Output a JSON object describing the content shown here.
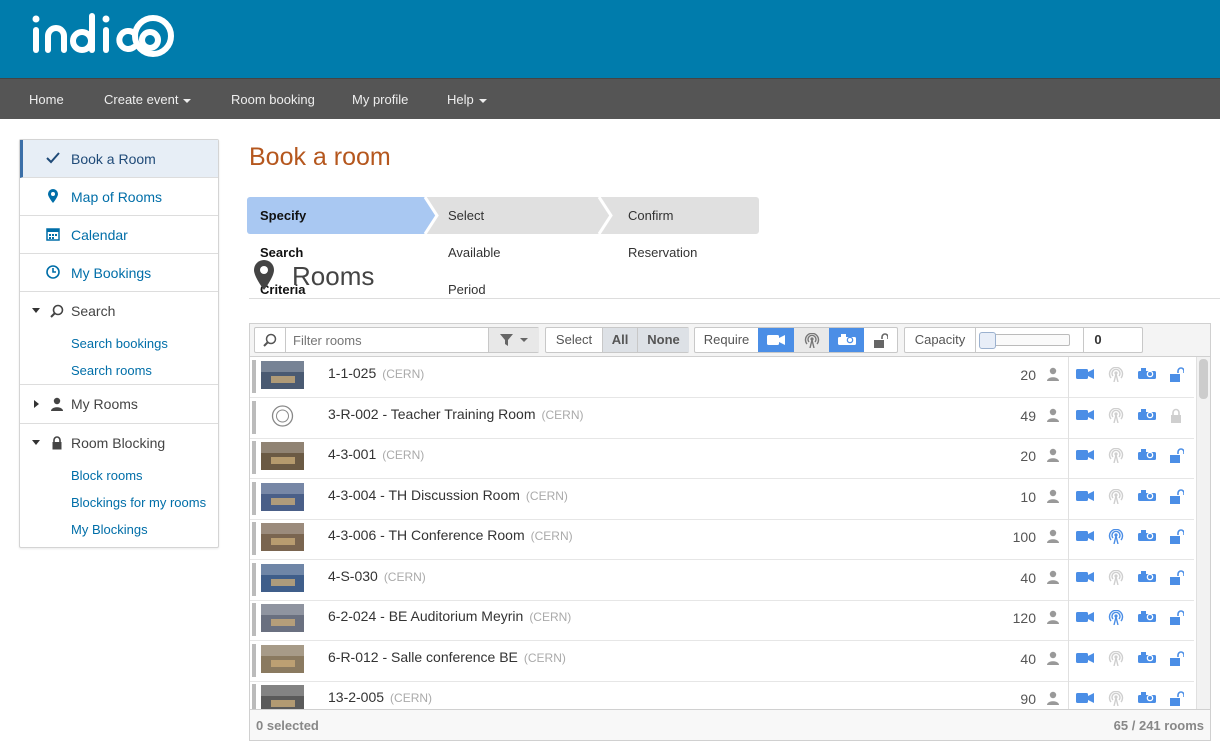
{
  "brand": {
    "logo_text": "indico",
    "header_color": "#007cac"
  },
  "nav": {
    "home": "Home",
    "create_event": "Create event",
    "room_booking": "Room booking",
    "my_profile": "My profile",
    "help": "Help"
  },
  "sidebar": {
    "book_room": "Book a Room",
    "map_rooms": "Map of Rooms",
    "calendar": "Calendar",
    "my_bookings": "My Bookings",
    "search": {
      "label": "Search",
      "items": [
        "Search bookings",
        "Search rooms"
      ]
    },
    "my_rooms": {
      "label": "My Rooms"
    },
    "room_blocking": {
      "label": "Room Blocking",
      "items": [
        "Block rooms",
        "Blockings for my rooms",
        "My Blockings"
      ]
    }
  },
  "main": {
    "title": "Book a room",
    "steps": [
      "Specify Search Criteria",
      "Select Available Period",
      "Confirm Reservation"
    ],
    "rooms_heading": "Rooms"
  },
  "toolbar": {
    "filter_placeholder": "Filter rooms",
    "select_label": "Select",
    "select_all": "All",
    "select_none": "None",
    "require_label": "Require",
    "capacity_label": "Capacity",
    "capacity_value": "0",
    "capacity_slider_fraction": 0
  },
  "rooms": [
    {
      "name": "1-1-025",
      "loc": "(CERN)",
      "cap": "20",
      "webcast": false,
      "bookable": true
    },
    {
      "name": "3-R-002 - Teacher Training Room",
      "loc": "(CERN)",
      "cap": "49",
      "webcast": false,
      "bookable": false
    },
    {
      "name": "4-3-001",
      "loc": "(CERN)",
      "cap": "20",
      "webcast": false,
      "bookable": true
    },
    {
      "name": "4-3-004 - TH Discussion Room",
      "loc": "(CERN)",
      "cap": "10",
      "webcast": false,
      "bookable": true
    },
    {
      "name": "4-3-006 - TH Conference Room",
      "loc": "(CERN)",
      "cap": "100",
      "webcast": true,
      "bookable": true
    },
    {
      "name": "4-S-030",
      "loc": "(CERN)",
      "cap": "40",
      "webcast": false,
      "bookable": true
    },
    {
      "name": "6-2-024 - BE Auditorium Meyrin",
      "loc": "(CERN)",
      "cap": "120",
      "webcast": true,
      "bookable": true
    },
    {
      "name": "6-R-012 - Salle conference BE",
      "loc": "(CERN)",
      "cap": "40",
      "webcast": false,
      "bookable": true
    },
    {
      "name": "13-2-005",
      "loc": "(CERN)",
      "cap": "90",
      "webcast": false,
      "bookable": true
    }
  ],
  "footer": {
    "selected": "0 selected",
    "count": "65 / 241 rooms"
  },
  "colors": {
    "accent_blue": "#4b8ee6",
    "title_orange": "#b5571e",
    "step_active": "#a9c8f2"
  }
}
